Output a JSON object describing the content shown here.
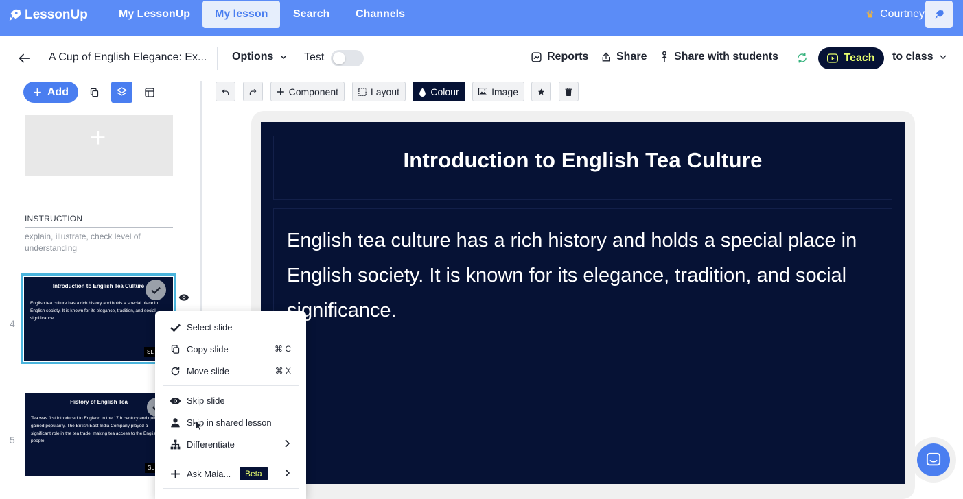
{
  "nav": {
    "logo": "LessonUp",
    "links": [
      "My LessonUp",
      "My lesson",
      "Search",
      "Channels"
    ],
    "user": "Courtney"
  },
  "lesson": {
    "title": "A Cup of English Elegance: Ex...",
    "options": "Options",
    "test": "Test",
    "reports": "Reports",
    "share": "Share",
    "share_students": "Share with students",
    "teach": "Teach",
    "to_class": "to class"
  },
  "sidebar": {
    "add": "Add",
    "instruction_title": "INSTRUCTION",
    "instruction_desc": "explain, illustrate, check level of understanding",
    "slides": [
      {
        "number": "4",
        "title": "Introduction to English Tea Culture",
        "body": "English tea culture has a rich history and holds a special place in English society. It is known for its elegance, tradition, and social significance.",
        "badge": "SL"
      },
      {
        "number": "5",
        "title": "History of English Tea",
        "body": "Tea was first introduced to England in the 17th century and quickly gained popularity. The British East India Company played a significant role in the tea trade, making tea access to the English people.",
        "badge": "SL"
      }
    ]
  },
  "toolbar": {
    "component": "Component",
    "layout": "Layout",
    "colour": "Colour",
    "image": "Image"
  },
  "slide": {
    "title": "Introduction to English Tea Culture",
    "body": "English tea culture has a rich history and holds a special place in English society. It is known for its elegance, tradition, and social significance."
  },
  "context_menu": {
    "select": "Select slide",
    "copy": "Copy slide",
    "copy_shortcut": "⌘ C",
    "move": "Move slide",
    "move_shortcut": "⌘ X",
    "skip": "Skip slide",
    "skip_shared": "Skip in shared lesson",
    "differentiate": "Differentiate",
    "ask": "Ask Maia...",
    "beta": "Beta"
  },
  "colors": {
    "nav_bg": "#5b8cf7",
    "accent": "#4a7ef0",
    "slide_bg": "#061235",
    "teach_text": "#e8ff6e",
    "selection_border": "#4ab4dc"
  }
}
